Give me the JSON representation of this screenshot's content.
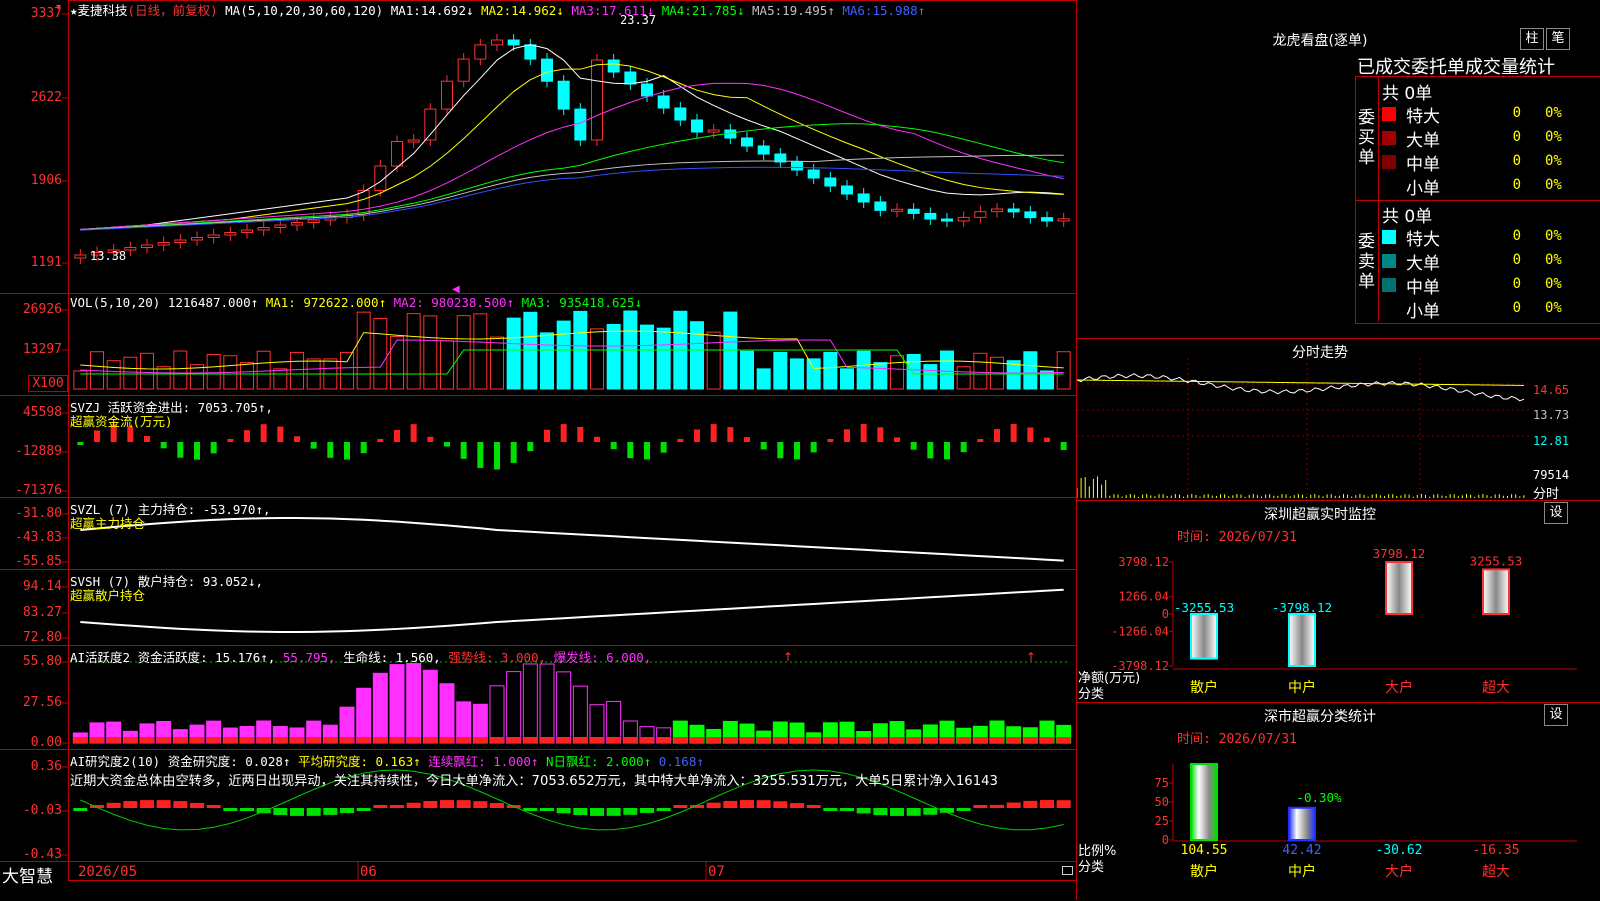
{
  "main": {
    "app_name": "大智慧",
    "star": "★",
    "stock_name": "麦捷科技",
    "mode": "(日线，前复权)",
    "ma_params": "MA(5,10,20,30,60,120)",
    "ma": [
      {
        "label": "MA1:",
        "value": "14.692↓",
        "color": "#ffffff"
      },
      {
        "label": "MA2:",
        "value": "14.962↓",
        "color": "#ffff00"
      },
      {
        "label": "MA3:",
        "value": "17.611↓",
        "color": "#ff30ff"
      },
      {
        "label": "MA4:",
        "value": "21.785↓",
        "color": "#00ff00"
      },
      {
        "label": "MA5:",
        "value": "19.495↑",
        "color": "#c0c0c0"
      },
      {
        "label": "MA6:",
        "value": "15.988↑",
        "color": "#4060ff"
      }
    ],
    "y_ticks": [
      "3337",
      "2622",
      "1906",
      "1191"
    ],
    "high_label": "23.37",
    "low_label": "13.38",
    "x_labels": [
      "2026/05",
      "06",
      "07"
    ]
  },
  "vol": {
    "header": "VOL(5,10,20)",
    "value": "1216487.000↑",
    "ma1": "MA1: 972622.000↑",
    "ma2": "MA2: 980238.500↑",
    "ma3": "MA3: 935418.625↓",
    "y_ticks": [
      "26926",
      "13297",
      "X100"
    ]
  },
  "svzj": {
    "header": "SVZJ  活跃资金进出: 7053.705↑,",
    "sub": "超赢资金流(万元)",
    "y_ticks": [
      "45598",
      "-12889",
      "-71376"
    ]
  },
  "svzl": {
    "header": "SVZL (7) 主力持仓: -53.970↑,",
    "sub": "超赢主力持仓",
    "y_ticks": [
      "-31.80",
      "-43.83",
      "-55.85"
    ]
  },
  "svsh": {
    "header": "SVSH (7) 散户持仓: 93.052↓,",
    "sub": "超赢散户持仓",
    "y_ticks": [
      "94.14",
      "83.27",
      "72.80"
    ]
  },
  "ai_active": {
    "header": "AI活跃度2 资金活跃度: 15.176↑,",
    "v2": "55.795,",
    "v3": "生命线: 1.560,",
    "v4": "强势线: 3.000,",
    "v5": "爆发线: 6.000,",
    "y_ticks": [
      "55.80",
      "27.56",
      "0.00"
    ]
  },
  "ai_research": {
    "header": "AI研究度2(10) 资金研究度: 0.028↑",
    "v2": "平均研究度: 0.163↑",
    "v3": "连续飘红: 1.000↑",
    "v4": "N日飘红: 2.000↑",
    "v5": "0.168↑",
    "note": "近期大资金总体由空转多，近两日出现异动，关注其持续性，今日大单净流入：7053.652万元，其中特大单净流入：3255.531万元，大单5日累计净入16143",
    "y_ticks": [
      "0.36",
      "-0.03",
      "-0.43"
    ]
  },
  "lhb": {
    "title": "龙虎看盘(逐单)",
    "btn1": "柱",
    "btn2": "笔",
    "tabs": "已成交委托单成交量统计",
    "buy_label": "委买单",
    "sell_label": "委卖单",
    "buy_total": "共 0单",
    "sell_total": "共 0单",
    "buy_rows": [
      {
        "name": "特大",
        "count": "0",
        "pct": "0%",
        "color": "#ff0000"
      },
      {
        "name": "大单",
        "count": "0",
        "pct": "0%",
        "color": "#a00000"
      },
      {
        "name": "中单",
        "count": "0",
        "pct": "0%",
        "color": "#800000"
      },
      {
        "name": "小单",
        "count": "0",
        "pct": "0%",
        "color": "#000000"
      }
    ],
    "sell_rows": [
      {
        "name": "特大",
        "count": "0",
        "pct": "0%",
        "color": "#00ffff"
      },
      {
        "name": "大单",
        "count": "0",
        "pct": "0%",
        "color": "#008888"
      },
      {
        "name": "中单",
        "count": "0",
        "pct": "0%",
        "color": "#007070"
      },
      {
        "name": "小单",
        "count": "0",
        "pct": "0%",
        "color": "#000000"
      }
    ]
  },
  "intraday": {
    "title": "分时走势",
    "y_ticks": [
      "14.65",
      "13.73",
      "12.81",
      "79514"
    ],
    "bottom": "分时"
  },
  "sz_monitor": {
    "title": "深圳超赢实时监控",
    "btn": "设",
    "time": "时间: 2026/07/31",
    "y_ticks": [
      "3798.12",
      "1266.04",
      "0",
      "-1266.04",
      "-3798.12"
    ],
    "bar_labels": [
      "-3255.53",
      "-3798.12",
      "3798.12",
      "3255.53"
    ],
    "bar_values": [
      -3255.53,
      -3798.12,
      3798.12,
      3255.53
    ],
    "ylim": [
      -3798.12,
      3798.12
    ],
    "axis_name1": "净额(万元)",
    "axis_name2": "分类",
    "categories": [
      "散户",
      "中户",
      "大户",
      "超大"
    ]
  },
  "sz_class": {
    "title": "深市超赢分类统计",
    "btn": "设",
    "time": "时间: 2026/07/31",
    "y_ticks": [
      "75",
      "50",
      "25",
      "0"
    ],
    "bar_values": [
      104.55,
      42.42,
      -30.62,
      -16.35
    ],
    "bar_top_label": "-0.30%",
    "value_labels": [
      "104.55",
      "42.42",
      "-30.62",
      "-16.35"
    ],
    "axis_name1": "比例%",
    "axis_name2": "分类",
    "categories": [
      "散户",
      "中户",
      "大户",
      "超大"
    ]
  }
}
